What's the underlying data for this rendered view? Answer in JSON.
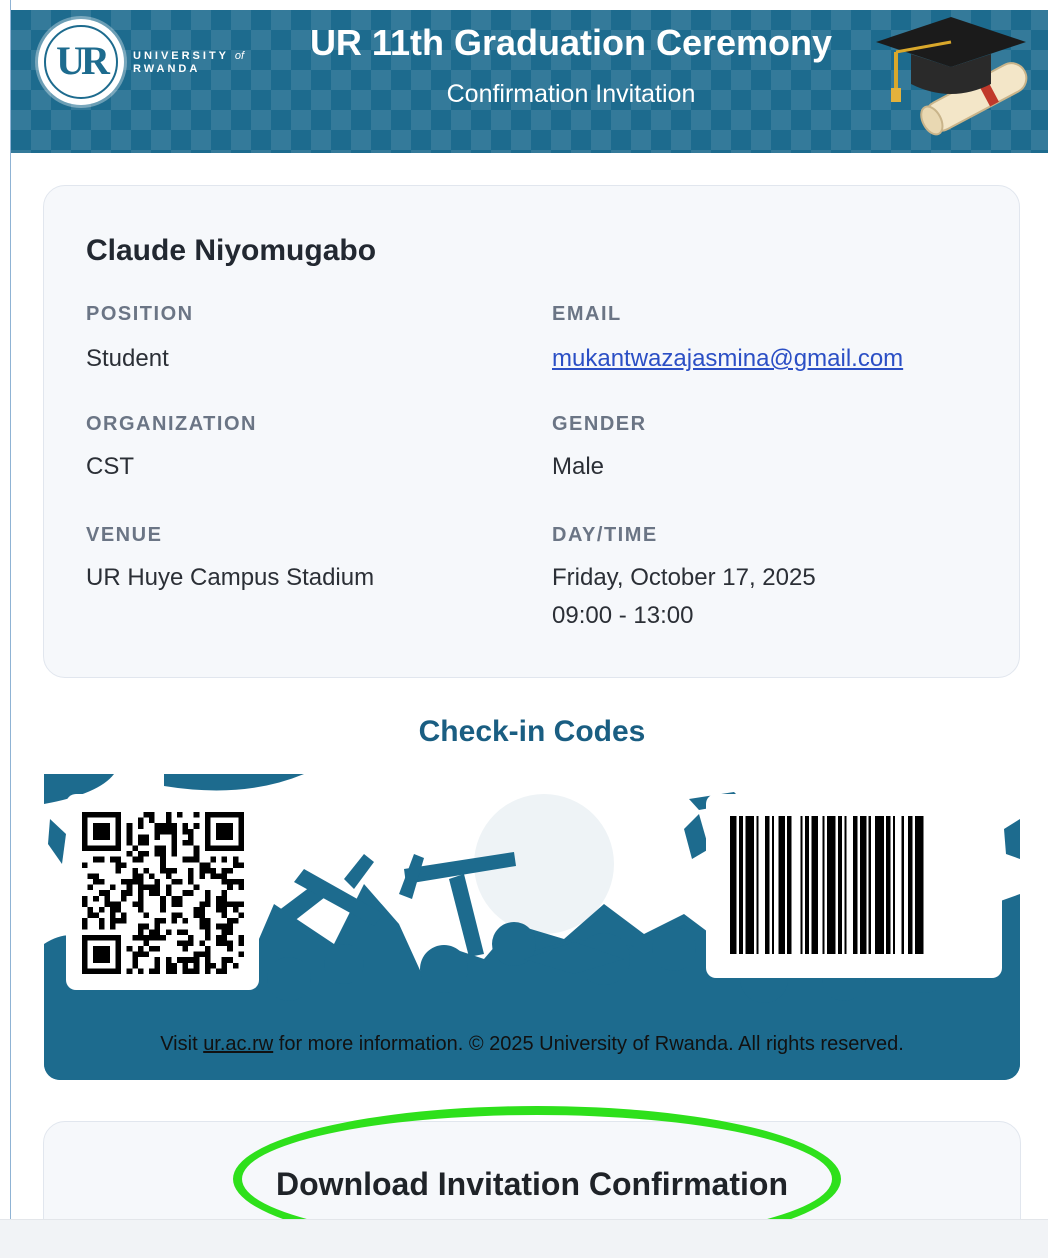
{
  "header": {
    "title": "UR 11th Graduation Ceremony",
    "subtitle": "Confirmation Invitation",
    "logo": {
      "mark": "UR",
      "line1": "UNIVERSITY",
      "of": "of",
      "line2": "RWANDA"
    },
    "icon": "graduation-cap-and-diploma-icon"
  },
  "attendee": {
    "name": "Claude Niyomugabo",
    "fields": {
      "position": {
        "label": "POSITION",
        "value": "Student"
      },
      "email": {
        "label": "EMAIL",
        "value": "mukantwazajasmina@gmail.com"
      },
      "organization": {
        "label": "ORGANIZATION",
        "value": "CST"
      },
      "gender": {
        "label": "GENDER",
        "value": "Male"
      },
      "venue": {
        "label": "VENUE",
        "value": "UR Huye Campus Stadium"
      },
      "daytime": {
        "label": "DAY/TIME",
        "date": "Friday, October 17, 2025",
        "time": "09:00 - 13:00"
      }
    }
  },
  "checkin": {
    "title": "Check-in Codes",
    "qr_icon": "qr-code-icon",
    "barcode_icon": "barcode-icon"
  },
  "footer": {
    "prefix": "Visit ",
    "link": "ur.ac.rw",
    "suffix": " for more information. © 2025 University of Rwanda. All rights reserved."
  },
  "download": {
    "label": "Download Invitation Confirmation"
  },
  "colors": {
    "brand": "#1d6b8e",
    "heading": "#1a5e82",
    "highlight": "#2ee01b",
    "link": "#2b4fc5"
  }
}
